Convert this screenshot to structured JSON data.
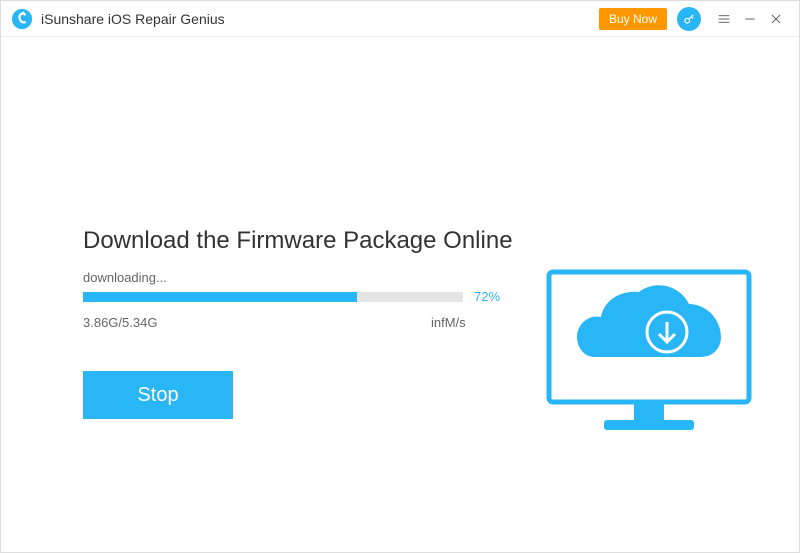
{
  "titlebar": {
    "app_title": "iSunshare iOS Repair Genius",
    "buy_now_label": "Buy Now"
  },
  "main": {
    "heading": "Download the Firmware Package Online",
    "status": "downloading...",
    "progress_percent": 72,
    "progress_percent_label": "72%",
    "size_text": "3.86G/5.34G",
    "speed_text": "infM/s",
    "stop_label": "Stop"
  },
  "colors": {
    "accent": "#29b6f6",
    "buy_now": "#ff9800"
  }
}
